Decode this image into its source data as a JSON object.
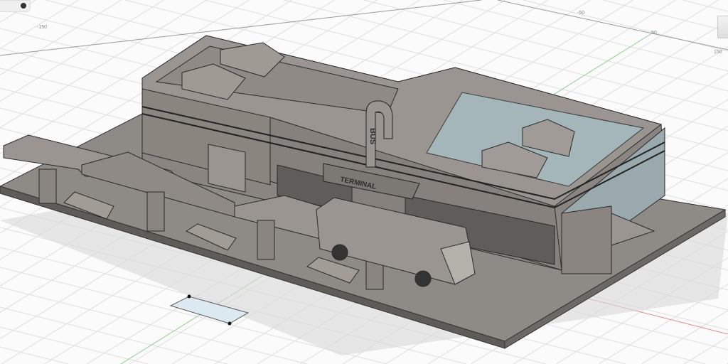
{
  "viewport": {
    "axis_labels": [
      "-150",
      "-50",
      "50",
      "150"
    ],
    "model": {
      "sign_vertical": "BUS",
      "sign_horizontal": "TERMINAL"
    }
  },
  "colors": {
    "grid": "#dcdcdc",
    "x_axis": "#e07a7a",
    "y_axis": "#7cc47c",
    "model": "#8f8a84",
    "glass": "#a9c6cf"
  }
}
